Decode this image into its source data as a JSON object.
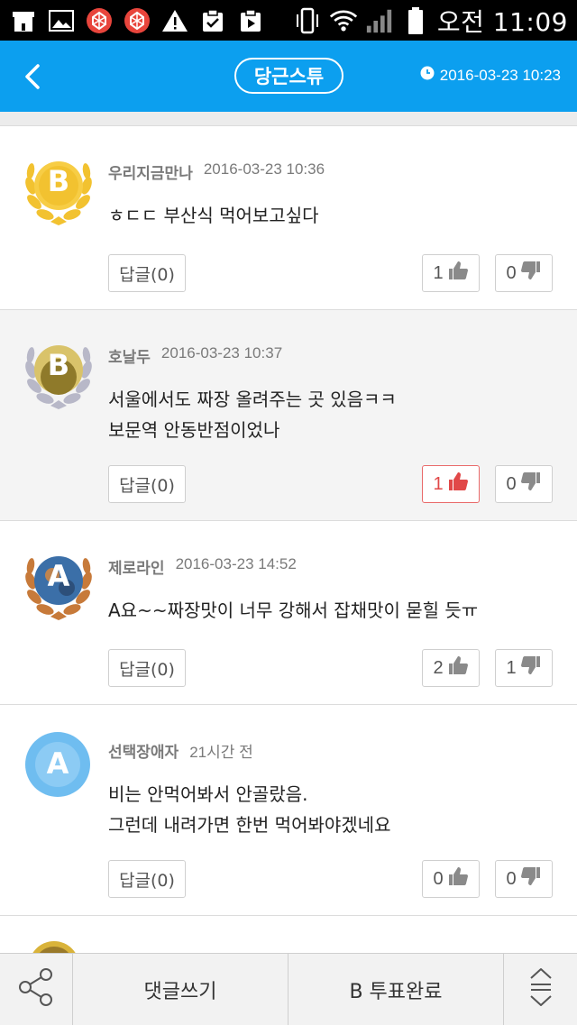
{
  "status_bar": {
    "time": "오전 11:09",
    "icons": [
      "store-icon",
      "image-icon",
      "app-red-icon",
      "app-red-icon",
      "warning-icon",
      "clipboard-check-icon",
      "video-clipboard-icon",
      "vibrate-icon",
      "wifi-icon",
      "signal-icon",
      "battery-icon"
    ]
  },
  "header": {
    "topic": "당근스튜",
    "datetime": "2016-03-23 10:23"
  },
  "comments": [
    {
      "author": "우리지금만나",
      "time": "2016-03-23 10:36",
      "text": "ㅎㄷㄷ 부산식 먹어보고싶다",
      "badge": "B",
      "reply_label": "답글(0)",
      "likes": "1",
      "dislikes": "0",
      "liked": false
    },
    {
      "author": "호날두",
      "time": "2016-03-23 10:37",
      "text": "서울에서도 짜장 올려주는 곳 있음ㅋㅋ\n보문역 안동반점이었나",
      "badge": "B",
      "reply_label": "답글(0)",
      "likes": "1",
      "dislikes": "0",
      "liked": true
    },
    {
      "author": "제로라인",
      "time": "2016-03-23 14:52",
      "text": "A요~~짜장맛이 너무 강해서 잡채맛이 묻힐 듯ㅠ",
      "badge": "A",
      "reply_label": "답글(0)",
      "likes": "2",
      "dislikes": "1",
      "liked": false
    },
    {
      "author": "선택장애자",
      "time": "21시간 전",
      "text": "비는 안먹어봐서 안골랐음.\n그런데 내려가면 한번 먹어봐야겠네요",
      "badge": "A",
      "reply_label": "답글(0)",
      "likes": "0",
      "dislikes": "0",
      "liked": false
    }
  ],
  "bottom_bar": {
    "write_label": "댓글쓰기",
    "vote_label": "B 투표완료"
  },
  "colors": {
    "header": "#0c9fef",
    "gold": "#f2c230",
    "silver": "#b8b8c8",
    "bronze": "#c77a3a",
    "blue_avatar": "#6fbdf0",
    "like_active": "#e14848"
  }
}
